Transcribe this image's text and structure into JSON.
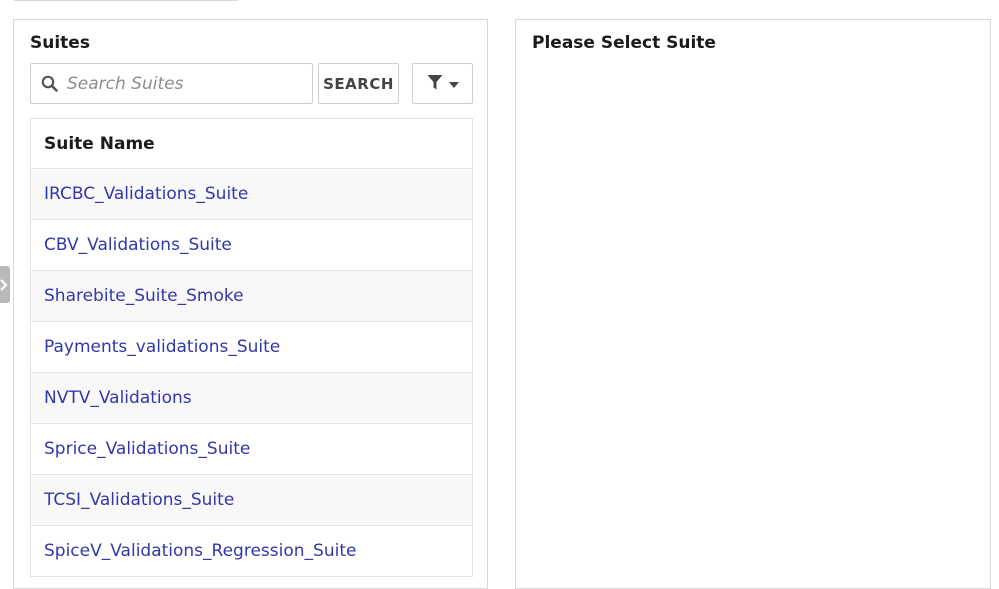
{
  "left_panel": {
    "title": "Suites",
    "search": {
      "placeholder": "Search Suites",
      "value": "",
      "icon": "search-icon"
    },
    "search_button_label": "SEARCH",
    "filter_button_icons": [
      "filter-icon",
      "caret-down-icon"
    ],
    "table": {
      "header": "Suite Name",
      "rows": [
        "IRCBC_Validations_Suite",
        "CBV_Validations_Suite",
        "Sharebite_Suite_Smoke",
        "Payments_validations_Suite",
        "NVTV_Validations",
        "Sprice_Validations_Suite",
        "TCSI_Validations_Suite",
        "SpiceV_Validations_Regression_Suite"
      ]
    }
  },
  "right_panel": {
    "title": "Please Select Suite"
  },
  "colors": {
    "link": "#3337a9",
    "border": "#d8d8d8",
    "row_alt": "#f8f8f8",
    "toggle": "#b9b9b9"
  }
}
